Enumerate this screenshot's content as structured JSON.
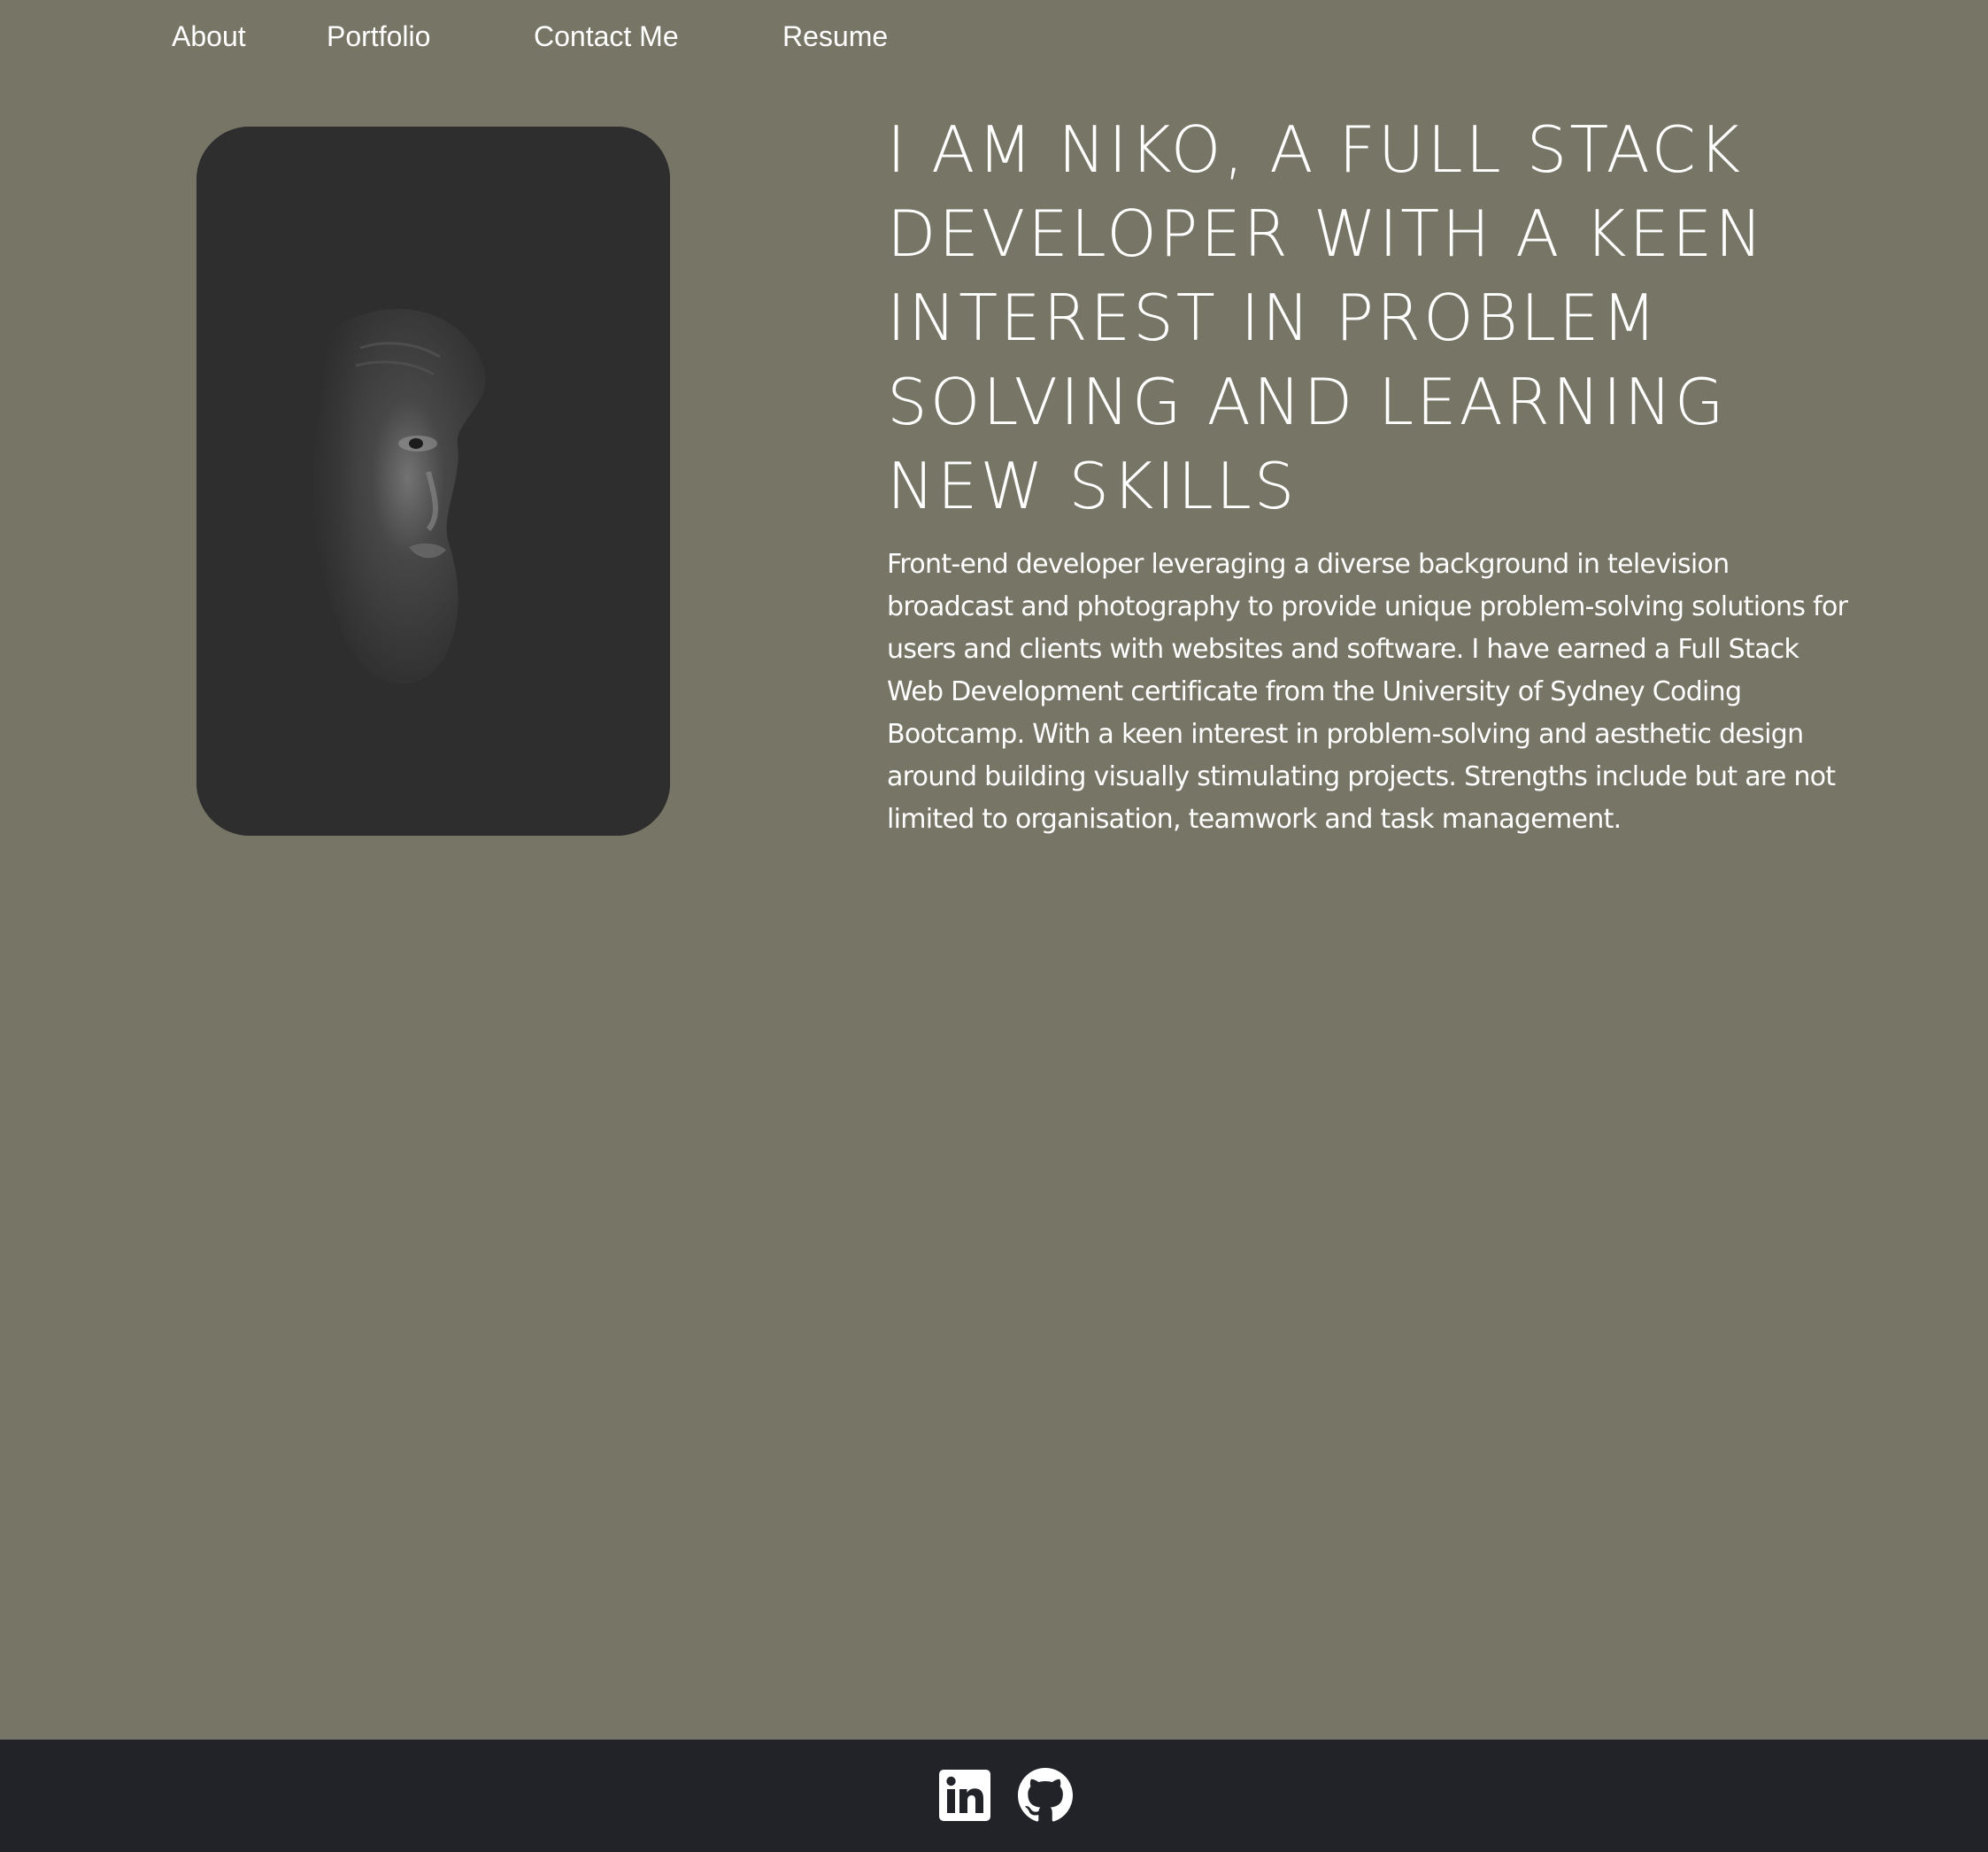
{
  "nav": {
    "items": [
      {
        "label": "About"
      },
      {
        "label": "Portfolio"
      },
      {
        "label": "Contact Me"
      },
      {
        "label": "Resume"
      }
    ]
  },
  "hero": {
    "headline": "I am Niko, a Full Stack Developer with a keen interest in problem solving and learning new skills",
    "bio": "Front-end developer leveraging a diverse background in television broadcast and photography to provide unique problem-solving solutions for users and clients with websites and software. I have earned a Full Stack Web Development certificate from the University of Sydney Coding Bootcamp. With a keen interest in problem-solving and aesthetic design around building visually stimulating projects. Strengths include but are not limited to organisation, teamwork and task management."
  },
  "footer": {
    "icons": [
      "linkedin-icon",
      "github-icon"
    ]
  },
  "colors": {
    "background": "#777566",
    "footer": "#212328",
    "text": "#ffffff",
    "portrait_bg": "#2e2e2f"
  }
}
